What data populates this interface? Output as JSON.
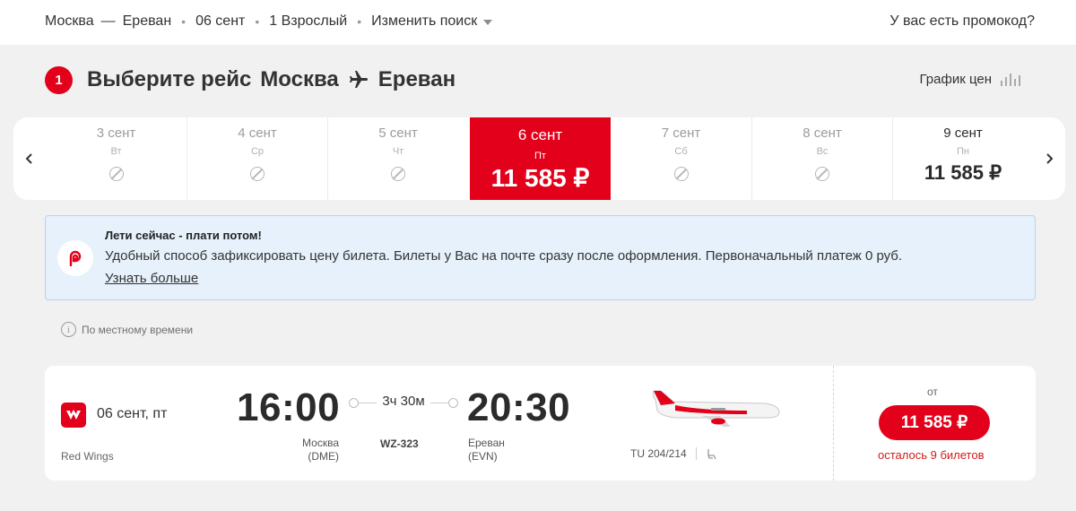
{
  "top_bar": {
    "route": {
      "from": "Москва",
      "separator": "—",
      "to": "Ереван"
    },
    "date": "06 сент",
    "passengers": "1 Взрослый",
    "change_search": "Изменить поиск",
    "promo": "У вас есть промокод?"
  },
  "heading": {
    "step": "1",
    "title_prefix": "Выберите рейс",
    "from": "Москва",
    "to": "Ереван",
    "price_graph": "График цен"
  },
  "date_carousel": {
    "days": [
      {
        "date": "3 сент",
        "weekday": "Вт",
        "available": false
      },
      {
        "date": "4 сент",
        "weekday": "Ср",
        "available": false
      },
      {
        "date": "5 сент",
        "weekday": "Чт",
        "available": false
      },
      {
        "date": "6 сент",
        "weekday": "Пт",
        "price": "11 585 ₽",
        "selected": true
      },
      {
        "date": "7 сент",
        "weekday": "Сб",
        "available": false
      },
      {
        "date": "8 сент",
        "weekday": "Вс",
        "available": false
      },
      {
        "date": "9 сент",
        "weekday": "Пн",
        "price": "11 585 ₽"
      }
    ]
  },
  "banner": {
    "title": "Лети сейчас - плати потом!",
    "text": "Удобный способ зафиксировать цену билета. Билеты у Вас на почте сразу после оформления. Первоначальный платеж 0 руб.",
    "link": "Узнать больше"
  },
  "local_time_note": "По местному времени",
  "flight": {
    "date": "06 сент, пт",
    "airline": "Red Wings",
    "departure_time": "16:00",
    "arrival_time": "20:30",
    "duration": "3ч 30м",
    "flight_number": "WZ-323",
    "departure_city": "Москва",
    "departure_code": "(DME)",
    "arrival_city": "Ереван",
    "arrival_code": "(EVN)",
    "aircraft": "TU 204/214",
    "price_prefix": "от",
    "price": "11 585 ₽",
    "tickets_left": "осталось 9 билетов"
  },
  "colors": {
    "accent": "#e2001a",
    "banner_bg": "#e6f1fb",
    "page_bg": "#f1f1f1"
  }
}
